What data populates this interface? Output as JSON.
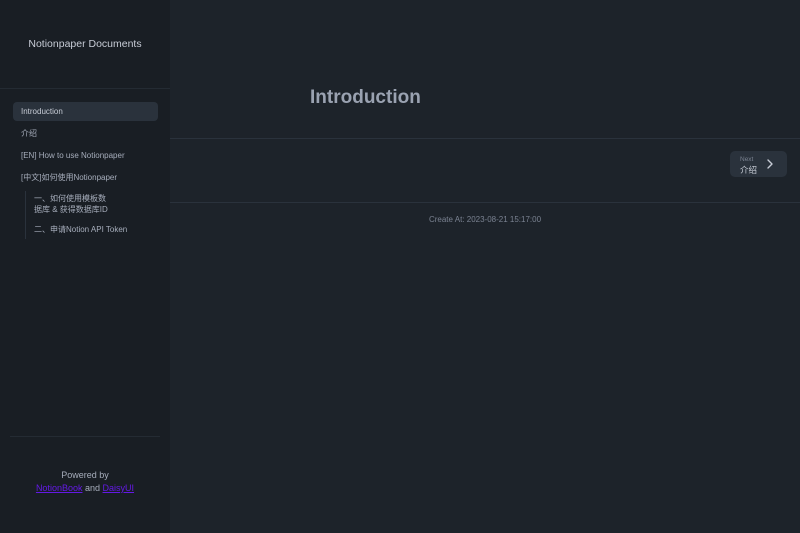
{
  "sidebar": {
    "brand": "Notionpaper Documents",
    "items": [
      {
        "label": "Introduction"
      },
      {
        "label": "介绍"
      },
      {
        "label": "[EN] How to use Notionpaper"
      },
      {
        "label": "[中文]如何使用Notionpaper"
      }
    ],
    "sub_items": [
      {
        "label_line1": "一、如何使用模板数",
        "label_line2": "据库 & 获得数据库ID"
      },
      {
        "label": "二、申请Notion API Token"
      }
    ],
    "footer": {
      "powered_by": "Powered by",
      "link1": "NotionBook",
      "and": "and",
      "link2": "DaisyUI"
    }
  },
  "main": {
    "title": "Introduction",
    "next": {
      "small_label": "Next",
      "title": "介绍",
      "icon": "chevron-right-icon"
    },
    "created_at": "Create At: 2023-08-21 15:17:00"
  },
  "colors": {
    "background": "#1d232a",
    "sidebar": "#191e24",
    "active_item": "#2a323c",
    "link": "#6419e6"
  }
}
